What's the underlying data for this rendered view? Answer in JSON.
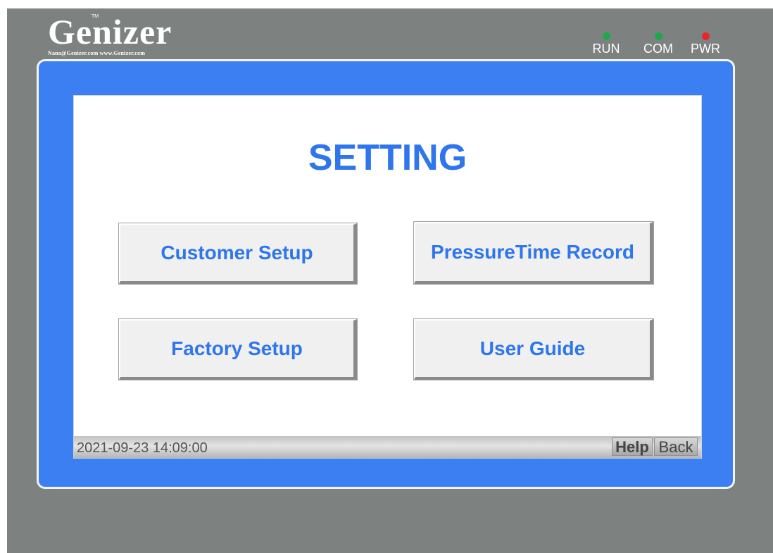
{
  "brand": {
    "name": "Genizer",
    "trademark": "TM",
    "contact": "Nano@Genizer.com  www.Genizer.com"
  },
  "indicators": [
    {
      "label": "RUN",
      "color": "#1fa84a"
    },
    {
      "label": "COM",
      "color": "#1fa84a"
    },
    {
      "label": "PWR",
      "color": "#e8262a"
    }
  ],
  "screen": {
    "title": "SETTING",
    "buttons": {
      "customer_setup": "Customer Setup",
      "pressure_time_record": "PressureTime Record",
      "factory_setup": "Factory Setup",
      "user_guide": "User Guide"
    }
  },
  "status_bar": {
    "datetime": "2021-09-23 14:09:00",
    "help_label": "Help",
    "back_label": "Back"
  },
  "colors": {
    "accent": "#2f76ec",
    "frame": "#3b7ff2",
    "bezel": "#7d8281"
  }
}
